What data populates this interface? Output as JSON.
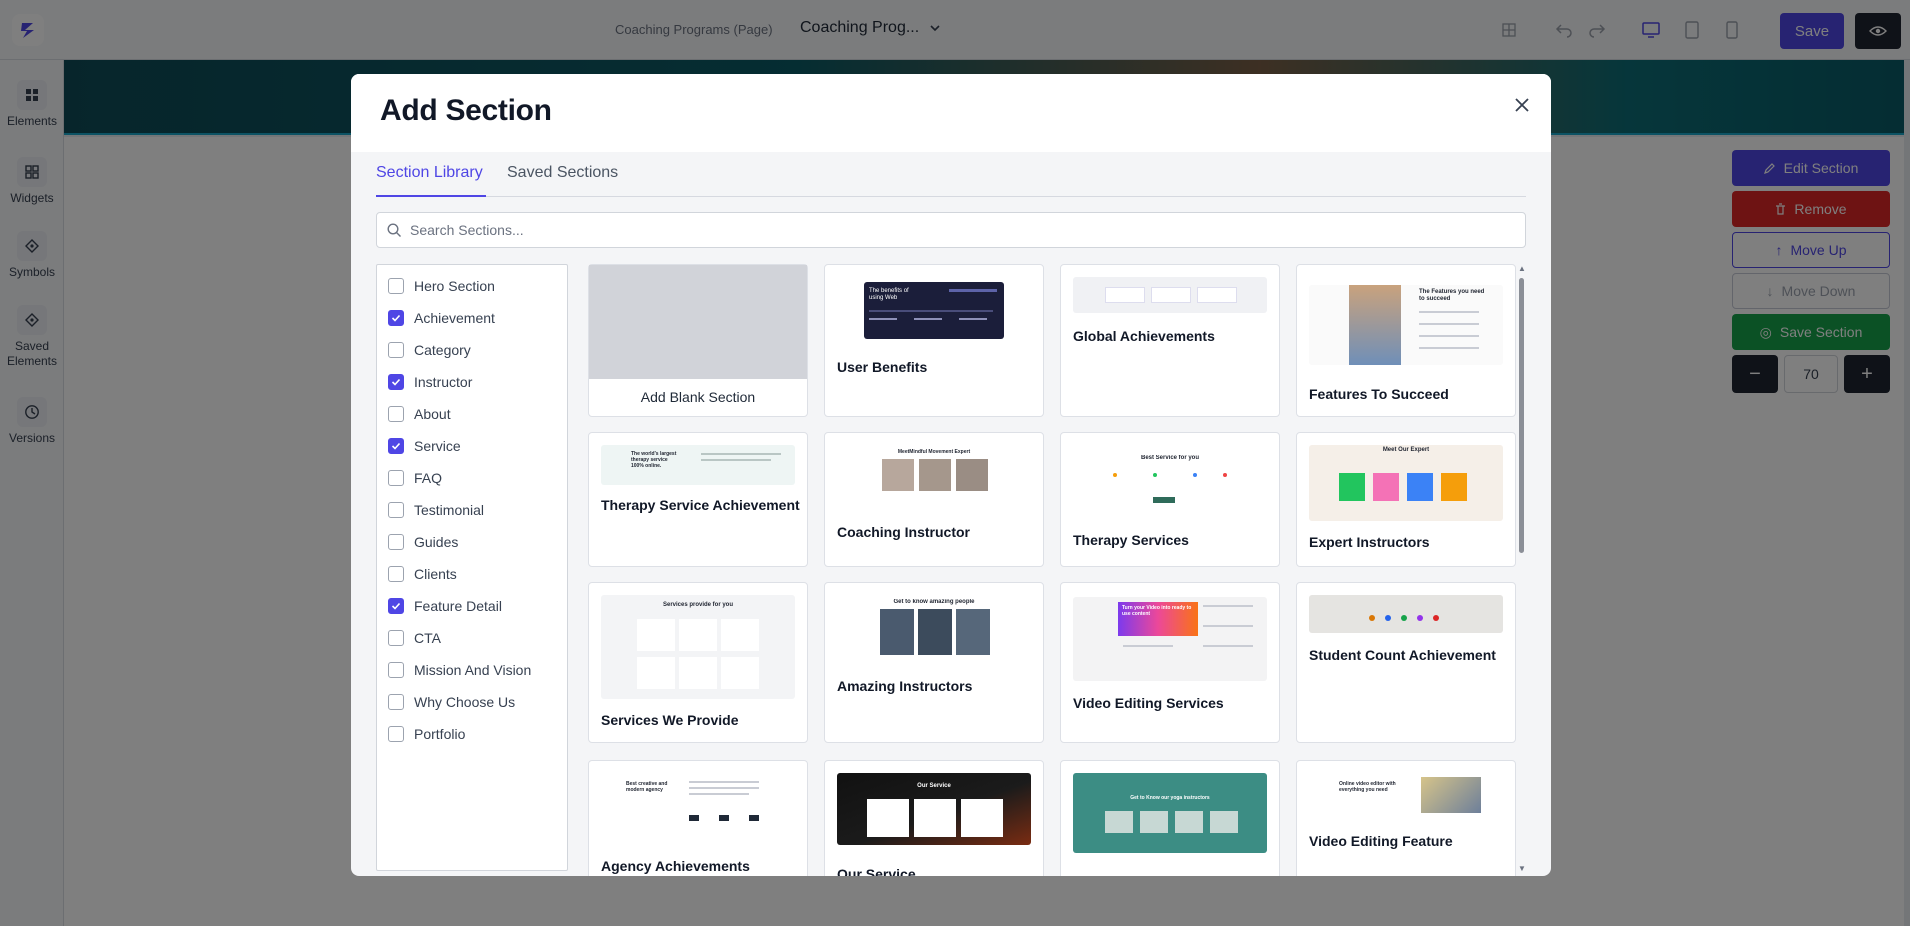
{
  "editor": {
    "page_name": "Coaching Programs (Page)",
    "page_select": "Coaching Prog...",
    "save_label": "Save",
    "sidebar": [
      {
        "label": "Elements",
        "icon": "elements-icon"
      },
      {
        "label": "Widgets",
        "icon": "widgets-icon"
      },
      {
        "label": "Symbols",
        "icon": "symbols-icon"
      },
      {
        "label": "Saved Elements",
        "icon": "saved-elements-icon"
      },
      {
        "label": "Versions",
        "icon": "versions-icon"
      }
    ],
    "section_panel": {
      "edit": "Edit Section",
      "remove": "Remove",
      "move_up": "Move Up",
      "move_down": "Move Down",
      "save": "Save Section",
      "zoom": "70",
      "minus": "−",
      "plus": "+"
    }
  },
  "modal": {
    "title": "Add Section",
    "tabs": [
      {
        "label": "Section Library",
        "active": true
      },
      {
        "label": "Saved Sections",
        "active": false
      }
    ],
    "search_placeholder": "Search Sections...",
    "categories": [
      {
        "label": "Hero Section",
        "checked": false
      },
      {
        "label": "Achievement",
        "checked": true
      },
      {
        "label": "Category",
        "checked": false
      },
      {
        "label": "Instructor",
        "checked": true
      },
      {
        "label": "About",
        "checked": false
      },
      {
        "label": "Service",
        "checked": true
      },
      {
        "label": "FAQ",
        "checked": false
      },
      {
        "label": "Testimonial",
        "checked": false
      },
      {
        "label": "Guides",
        "checked": false
      },
      {
        "label": "Clients",
        "checked": false
      },
      {
        "label": "Feature Detail",
        "checked": true
      },
      {
        "label": "CTA",
        "checked": false
      },
      {
        "label": "Mission And Vision",
        "checked": false
      },
      {
        "label": "Why Choose Us",
        "checked": false
      },
      {
        "label": "Portfolio",
        "checked": false
      }
    ],
    "cards": [
      {
        "title": "Add Blank Section"
      },
      {
        "title": "User Benefits",
        "thumb_text": "The benefits of using Web"
      },
      {
        "title": "Global Achievements"
      },
      {
        "title": "Features To Succeed",
        "thumb_text": "The Features you need to succeed"
      },
      {
        "title": "Therapy Service Achievement",
        "thumb_text": "The world's largest therapy service 100% online."
      },
      {
        "title": "Coaching Instructor",
        "thumb_text": "MeetMindful Movement Expert"
      },
      {
        "title": "Therapy Services",
        "thumb_text": "Best Service for you"
      },
      {
        "title": "Expert Instructors",
        "thumb_text": "Meet Our Expert"
      },
      {
        "title": "Services We Provide",
        "thumb_text": "Services provide for you"
      },
      {
        "title": "Amazing Instructors",
        "thumb_text": "Get to know amazing people"
      },
      {
        "title": "Video Editing Services",
        "thumb_text": "Turn your Video into ready to use content"
      },
      {
        "title": "Student Count Achievement"
      },
      {
        "title": "Agency Achievements",
        "thumb_text": "Best creative and modern agency"
      },
      {
        "title": "Our Service",
        "thumb_text": "Our Service"
      },
      {
        "title": "",
        "thumb_text": "Get to Know our yoga instructors"
      },
      {
        "title": "Video Editing Feature",
        "thumb_text": "Online video editor with everything you need"
      }
    ]
  }
}
